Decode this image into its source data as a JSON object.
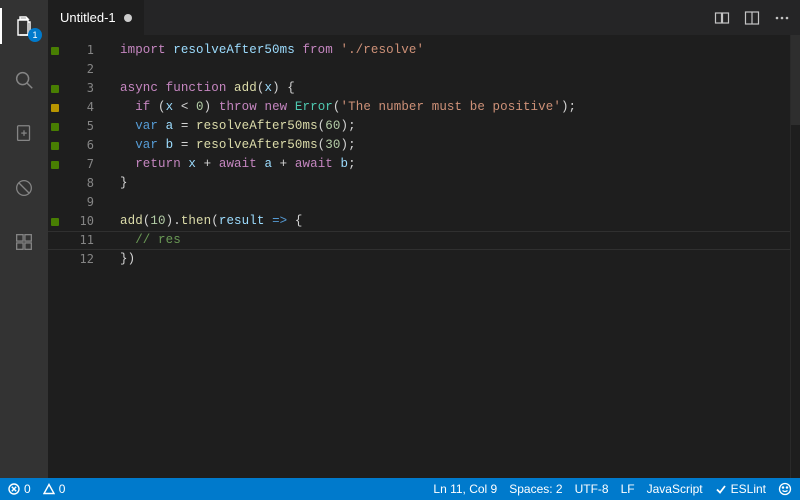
{
  "activitybar": {
    "explorer_badge": "1"
  },
  "tab": {
    "title": "Untitled-1"
  },
  "code": {
    "lines": [
      {
        "n": 1,
        "mark": "green",
        "tokens": [
          [
            "kw",
            "import"
          ],
          [
            "pun",
            " "
          ],
          [
            "var",
            "resolveAfter50ms"
          ],
          [
            "pun",
            " "
          ],
          [
            "kw",
            "from"
          ],
          [
            "pun",
            " "
          ],
          [
            "str",
            "'./resolve'"
          ]
        ]
      },
      {
        "n": 2,
        "mark": "",
        "tokens": []
      },
      {
        "n": 3,
        "mark": "green",
        "tokens": [
          [
            "kw",
            "async"
          ],
          [
            "pun",
            " "
          ],
          [
            "kw",
            "function"
          ],
          [
            "pun",
            " "
          ],
          [
            "fn",
            "add"
          ],
          [
            "pun",
            "("
          ],
          [
            "var",
            "x"
          ],
          [
            "pun",
            ") {"
          ]
        ]
      },
      {
        "n": 4,
        "mark": "yellow",
        "tokens": [
          [
            "pun",
            "  "
          ],
          [
            "kw",
            "if"
          ],
          [
            "pun",
            " ("
          ],
          [
            "var",
            "x"
          ],
          [
            "pun",
            " < "
          ],
          [
            "num",
            "0"
          ],
          [
            "pun",
            ") "
          ],
          [
            "kw",
            "throw"
          ],
          [
            "pun",
            " "
          ],
          [
            "kw",
            "new"
          ],
          [
            "pun",
            " "
          ],
          [
            "cls",
            "Error"
          ],
          [
            "pun",
            "("
          ],
          [
            "str",
            "'The number must be positive'"
          ],
          [
            "pun",
            ");"
          ]
        ]
      },
      {
        "n": 5,
        "mark": "green",
        "tokens": [
          [
            "pun",
            "  "
          ],
          [
            "type",
            "var"
          ],
          [
            "pun",
            " "
          ],
          [
            "var",
            "a"
          ],
          [
            "pun",
            " = "
          ],
          [
            "fn",
            "resolveAfter50ms"
          ],
          [
            "pun",
            "("
          ],
          [
            "num",
            "60"
          ],
          [
            "pun",
            ");"
          ]
        ]
      },
      {
        "n": 6,
        "mark": "green",
        "tokens": [
          [
            "pun",
            "  "
          ],
          [
            "type",
            "var"
          ],
          [
            "pun",
            " "
          ],
          [
            "var",
            "b"
          ],
          [
            "pun",
            " = "
          ],
          [
            "fn",
            "resolveAfter50ms"
          ],
          [
            "pun",
            "("
          ],
          [
            "num",
            "30"
          ],
          [
            "pun",
            ");"
          ]
        ]
      },
      {
        "n": 7,
        "mark": "green",
        "tokens": [
          [
            "pun",
            "  "
          ],
          [
            "kw",
            "return"
          ],
          [
            "pun",
            " "
          ],
          [
            "var",
            "x"
          ],
          [
            "pun",
            " + "
          ],
          [
            "kw",
            "await"
          ],
          [
            "pun",
            " "
          ],
          [
            "var",
            "a"
          ],
          [
            "pun",
            " + "
          ],
          [
            "kw",
            "await"
          ],
          [
            "pun",
            " "
          ],
          [
            "var",
            "b"
          ],
          [
            "pun",
            ";"
          ]
        ]
      },
      {
        "n": 8,
        "mark": "",
        "tokens": [
          [
            "pun",
            "}"
          ]
        ]
      },
      {
        "n": 9,
        "mark": "",
        "tokens": []
      },
      {
        "n": 10,
        "mark": "green",
        "tokens": [
          [
            "fn",
            "add"
          ],
          [
            "pun",
            "("
          ],
          [
            "num",
            "10"
          ],
          [
            "pun",
            ")."
          ],
          [
            "fn",
            "then"
          ],
          [
            "pun",
            "("
          ],
          [
            "var",
            "result"
          ],
          [
            "pun",
            " "
          ],
          [
            "type",
            "=>"
          ],
          [
            "pun",
            " {"
          ]
        ]
      },
      {
        "n": 11,
        "mark": "",
        "current": true,
        "tokens": [
          [
            "pun",
            "  "
          ],
          [
            "cmt",
            "// res"
          ]
        ]
      },
      {
        "n": 12,
        "mark": "",
        "tokens": [
          [
            "pun",
            "})"
          ]
        ]
      }
    ]
  },
  "status": {
    "errors": "0",
    "warnings": "0",
    "cursor": "Ln 11, Col 9",
    "spaces": "Spaces: 2",
    "encoding": "UTF-8",
    "eol": "LF",
    "language": "JavaScript",
    "eslint": "ESLint"
  }
}
